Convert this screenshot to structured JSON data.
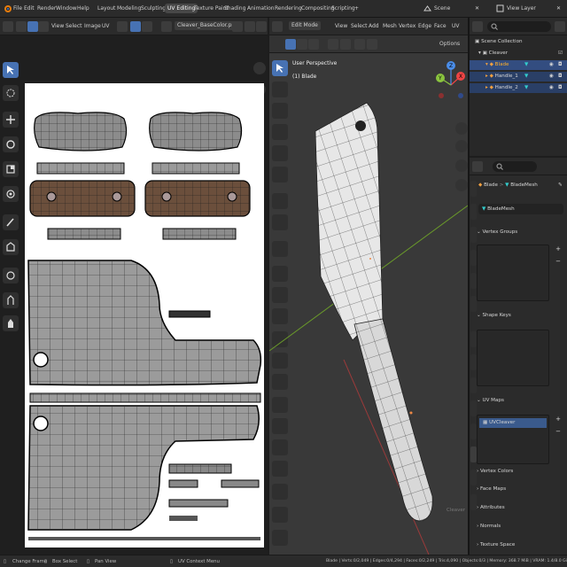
{
  "menu": {
    "items": [
      "File",
      "Edit",
      "Render",
      "Window",
      "Help"
    ],
    "workspaces": [
      "Layout",
      "Modeling",
      "Sculpting",
      "UV Editing",
      "Texture Paint",
      "Shading",
      "Animation",
      "Rendering",
      "Compositing",
      "Scripting"
    ],
    "active_workspace": "UV Editing",
    "add_tab": "+",
    "scene": "Scene",
    "view_layer": "View Layer"
  },
  "uv_editor": {
    "menus": [
      "View",
      "Select",
      "Image",
      "UV"
    ],
    "image_name": "Cleaver_BaseColor.png"
  },
  "viewport": {
    "mode": "Edit Mode",
    "menus": [
      "View",
      "Select",
      "Add",
      "Mesh",
      "Vertex",
      "Edge",
      "Face",
      "UV"
    ],
    "options": "Options",
    "perspective": "User Perspective",
    "object": "(1) Blade",
    "gizmo": {
      "x": "X",
      "y": "Y",
      "z": "Z"
    },
    "faint_label": "Cleaver"
  },
  "outliner": {
    "collection": "Scene Collection",
    "object": "Cleaver",
    "children": [
      "Blade",
      "Handle_1",
      "Handle_2"
    ],
    "selected": "Blade"
  },
  "properties": {
    "breadcrumb_object": "Blade",
    "breadcrumb_sep": ">",
    "breadcrumb_mesh": "BladeMesh",
    "mesh_name": "BladeMesh",
    "panels": {
      "vertex_groups": "Vertex Groups",
      "shape_keys": "Shape Keys",
      "uv_maps": "UV Maps",
      "vertex_colors": "Vertex Colors",
      "face_maps": "Face Maps",
      "attributes": "Attributes",
      "normals": "Normals",
      "texture_space": "Texture Space"
    },
    "uv_map_item": "UVCleaver",
    "add": "+",
    "remove": "−"
  },
  "status": {
    "change_frame": "Change Frame",
    "box_select": "Box Select",
    "pan_view": "Pan View",
    "context_menu": "UV Context Menu",
    "stats": "Blade | Verts:0/2,049 | Edges:0/4,294 | Faces:0/2,249 | Tris:4,090 | Objects:0/3 | Memory: 368.7 MiB | VRAM: 1.4/8.0 GiB | 3.0.0"
  }
}
